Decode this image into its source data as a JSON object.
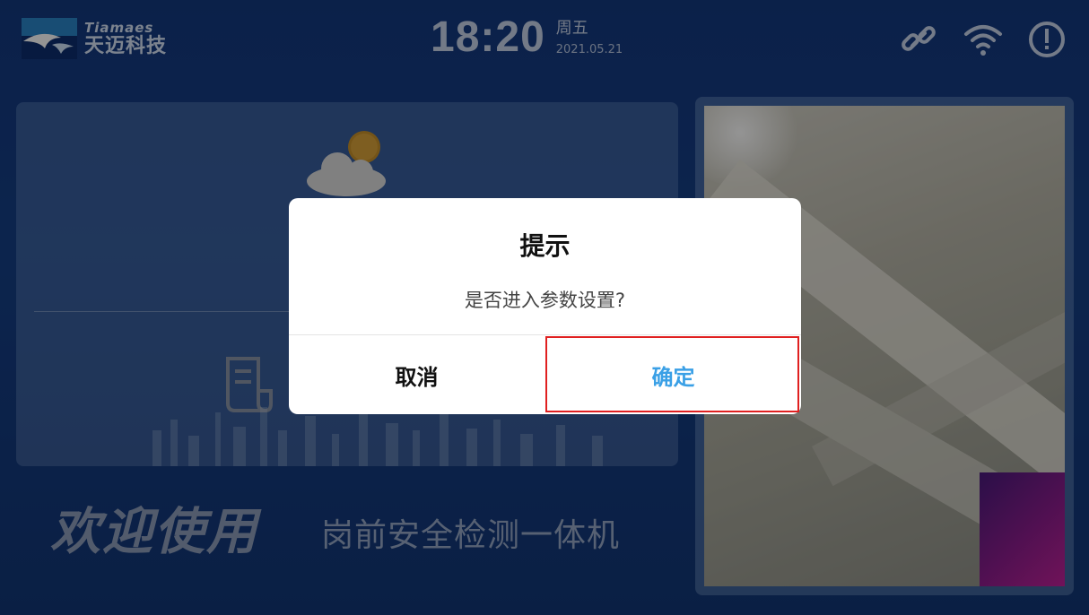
{
  "header": {
    "logo_en": "Tiamaes",
    "logo_cn": "天迈科技",
    "time": "18:20",
    "weekday": "周五",
    "date": "2021.05.21",
    "icons": [
      "link-icon",
      "wifi-icon",
      "alert-icon"
    ]
  },
  "main": {
    "welcome": "欢迎使用",
    "subtitle": "岗前安全检测一体机"
  },
  "dialog": {
    "title": "提示",
    "message": "是否进入参数设置?",
    "cancel_label": "取消",
    "ok_label": "确定"
  },
  "colors": {
    "background": "#163f86",
    "dialog_bg": "#ffffff",
    "ok_text": "#3aa0e6",
    "highlight": "#e02020"
  }
}
